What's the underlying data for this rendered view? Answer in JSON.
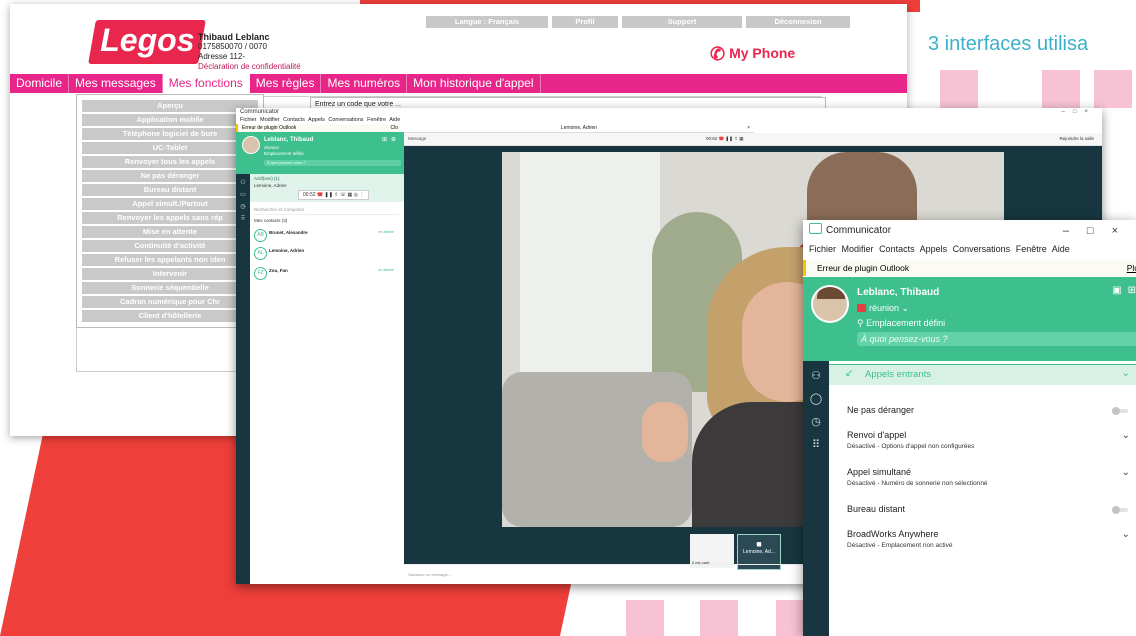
{
  "slide": {
    "title": "3 interfaces utilisa"
  },
  "portal": {
    "logo": "Legos",
    "user": {
      "name": "Thibaud Leblanc",
      "phone": "0175850070 / 0070",
      "address": "Adresse 112-",
      "privacy_link": "Déclaration de confidentialité"
    },
    "top_nav": [
      "Langue : Français",
      "Profil",
      "Support",
      "Déconnexion"
    ],
    "brand": "My Phone",
    "menu": [
      "Domicile",
      "Mes messages",
      "Mes fonctions",
      "Mes règles",
      "Mes numéros",
      "Mon historique d'appel"
    ],
    "active_menu": "Mes fonctions",
    "functions": [
      "Aperçu",
      "Application mobile",
      "Téléphone logiciel de bure",
      "UC-Tablet",
      "Renvoyer tous les appels",
      "Ne pas déranger",
      "Bureau distant",
      "Appel simult./Partout",
      "Renvoyer les appels sans rép",
      "Mise en attente",
      "Continuité d'activité",
      "Refuser les appelants non iden",
      "Intervenir",
      "Sonnerie séquentielle",
      "Cadran numérique pour Chr",
      "Client d'hôtellerie"
    ],
    "content_text": "Entrez un code que votre ..."
  },
  "communicator": {
    "window_title": "Communicator",
    "menu": "Fichier  Modifier  Contacts  Appels  Conversations  Fenêtre  Aide",
    "warning": "Erreur de plugin Outlook",
    "warning_link": "Clo",
    "profile": {
      "name": "Leblanc, Thibaud",
      "status": "réunion",
      "location": "Emplacement défini",
      "mood_placeholder": "À quoi pensez-vous ?"
    },
    "active_header": "Actif(ves) (1)",
    "active_contact": "Lemoine, Adrien",
    "active_time": "00:52",
    "search_placeholder": "Rechercher et Composer",
    "contacts_header": "Mes contacts (3)",
    "contacts": [
      {
        "name": "Brunet, Alexandre",
        "status": "en attente"
      },
      {
        "name": "Lemoine, Adrien",
        "status": ""
      },
      {
        "name": "Zou, Fan",
        "status": "en attente"
      }
    ],
    "conversation_tab": "Lemoine, Adrien",
    "call_time": "00:52",
    "call_bar_left": "Message",
    "call_bar_right": "Rejoindre la salle",
    "thumb_label": "Lemoine, Ad...",
    "thumb_small": "Il est parti",
    "chat_placeholder": "Saisissez un message..."
  },
  "zoom": {
    "window_title": "Communicator",
    "menu": [
      "Fichier",
      "Modifier",
      "Contacts",
      "Appels",
      "Conversations",
      "Fenêtre",
      "Aide"
    ],
    "warning": "Erreur de plugin Outlook",
    "warning_link": "Plu",
    "profile": {
      "name": "Leblanc, Thibaud",
      "status": "réunion",
      "location": "Emplacement défini",
      "mood_placeholder": "À quoi pensez-vous ?"
    },
    "section_title": "Appels entrants",
    "rows": [
      {
        "title": "Ne pas déranger",
        "sub": "",
        "control": "toggle"
      },
      {
        "title": "Renvoi d'appel",
        "sub": "Désactivé - Options d'appel non configurées",
        "control": "chevron"
      },
      {
        "title": "Appel simultané",
        "sub": "Désactivé - Numéro de sonnerie non sélectionné",
        "control": "chevron"
      },
      {
        "title": "Bureau distant",
        "sub": "",
        "control": "toggle"
      },
      {
        "title": "BroadWorks Anywhere",
        "sub": "Désactivé - Emplacement non activé",
        "control": "chevron"
      }
    ]
  }
}
